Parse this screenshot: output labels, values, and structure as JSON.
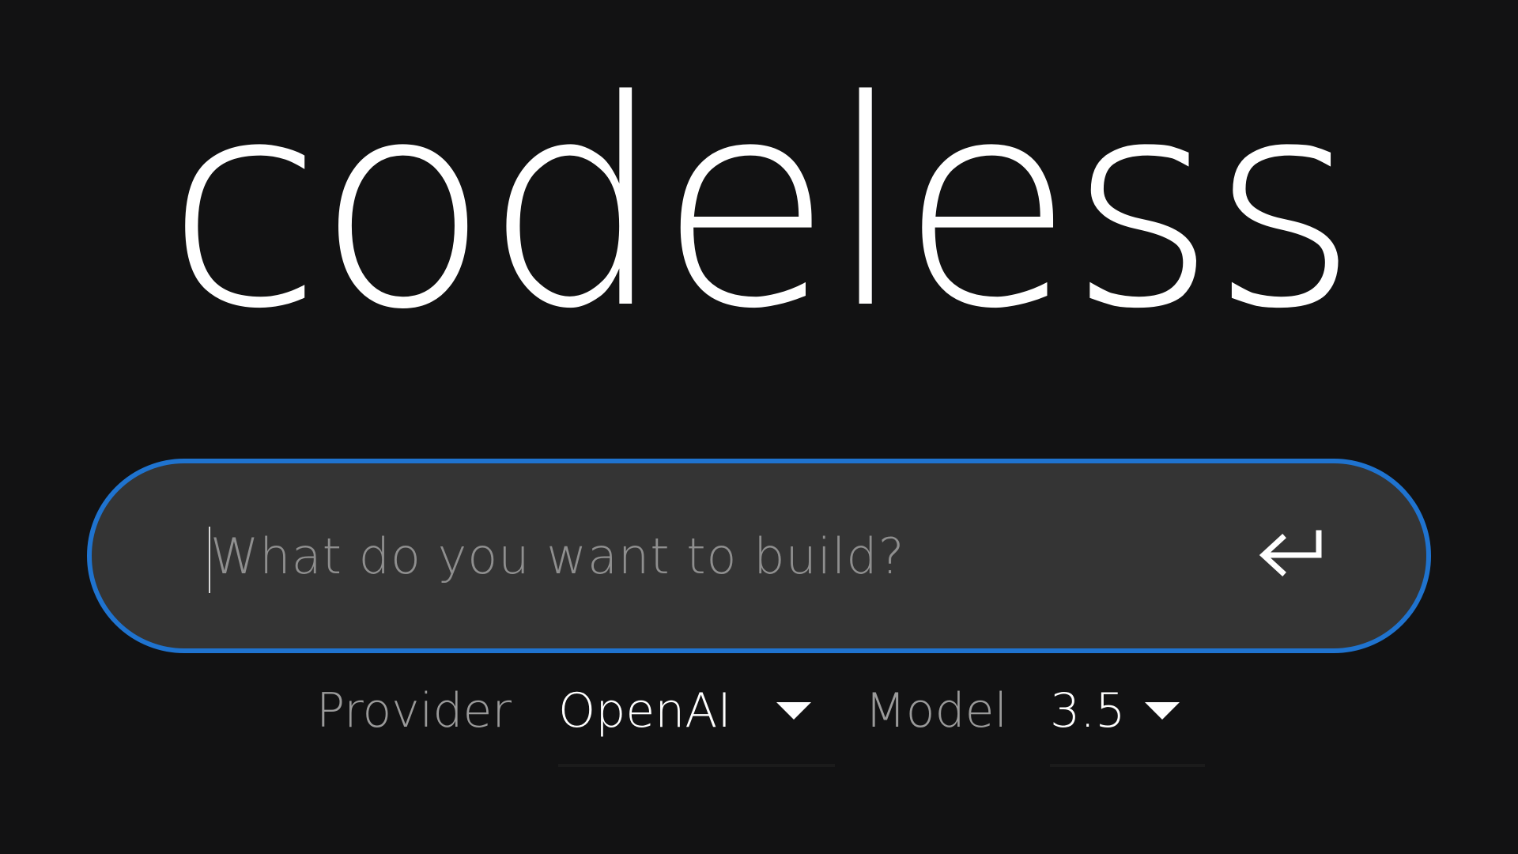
{
  "app": {
    "logo_text": "codeless"
  },
  "search": {
    "placeholder": "What do you want to build?",
    "value": ""
  },
  "controls": {
    "provider_label": "Provider",
    "provider_value": "OpenAI",
    "model_label": "Model",
    "model_value": "3.5"
  },
  "icons": {
    "submit": "enter-return-icon",
    "provider_dropdown": "chevron-down-icon",
    "model_dropdown": "chevron-down-icon"
  },
  "colors": {
    "background": "#121213",
    "input_background": "#343434",
    "focus_border": "#1f73cf",
    "text_primary": "#ffffff",
    "text_secondary": "#9a9a9a"
  }
}
